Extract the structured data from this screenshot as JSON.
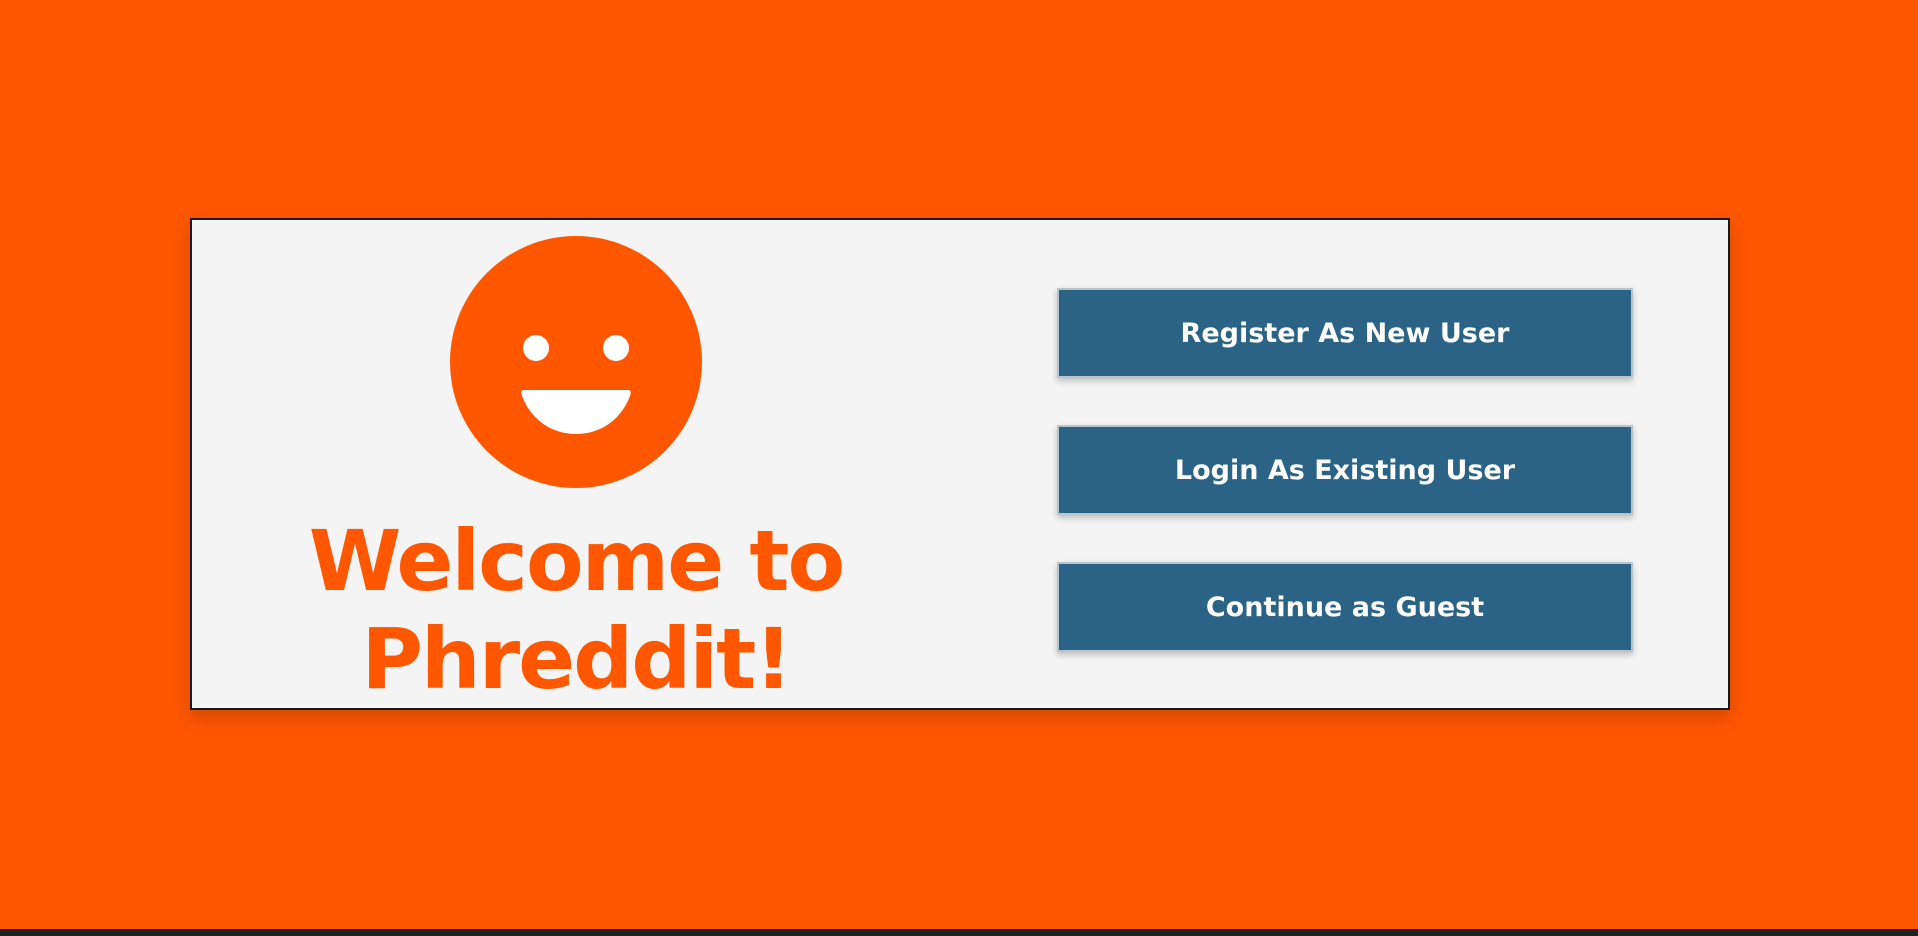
{
  "brand": {
    "logo_icon": "smiley-face-icon",
    "accent_color": "#ff5700",
    "welcome_line1": "Welcome to",
    "welcome_line2": "Phreddit!"
  },
  "actions": {
    "register_label": "Register As New User",
    "login_label": "Login As Existing User",
    "guest_label": "Continue as Guest",
    "button_color": "#2a6386"
  }
}
